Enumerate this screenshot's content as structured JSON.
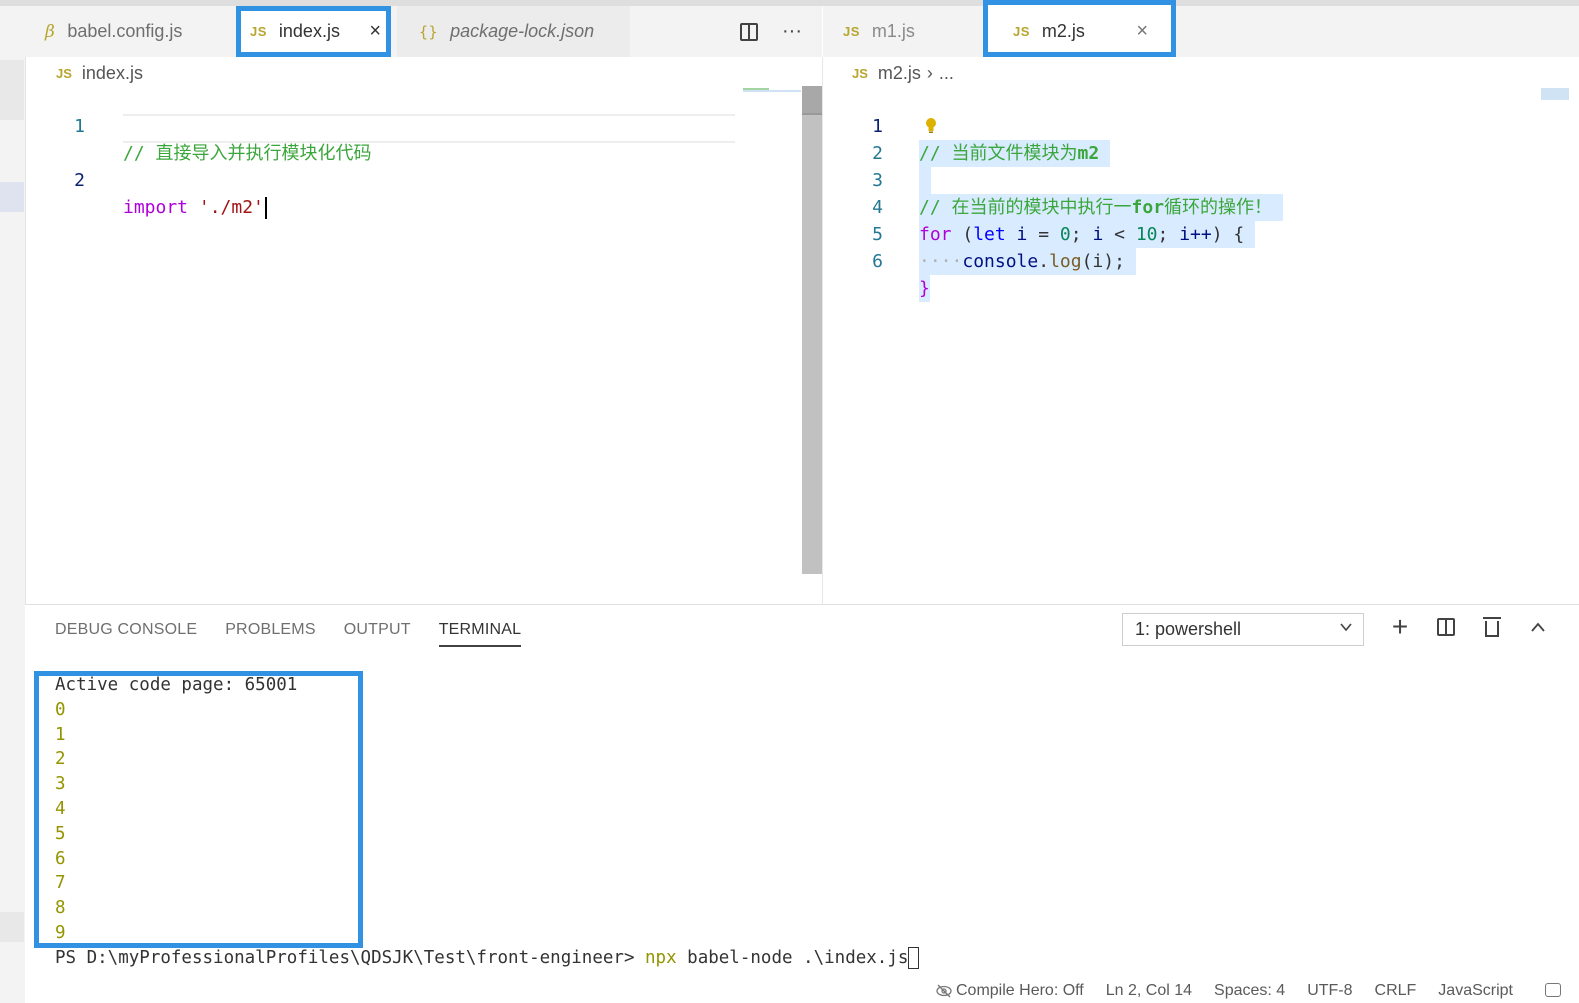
{
  "left_group": {
    "tabs": [
      {
        "icon": "babel-icon",
        "glyph": "β",
        "label": "babel.config.js",
        "active": false
      },
      {
        "icon": "js-icon",
        "glyph": "JS",
        "label": "index.js",
        "active": true,
        "close": "×"
      },
      {
        "icon": "json-icon",
        "glyph": "{}",
        "label": "package-lock.json",
        "active": false
      }
    ],
    "actions_more": "···",
    "breadcrumb": {
      "icon_glyph": "JS",
      "file": "index.js"
    },
    "lines": [
      {
        "n": "1",
        "comment": "// 直接导入并执行模块化代码"
      },
      {
        "n": "2",
        "kw": "import",
        "str": "'./m2'"
      }
    ]
  },
  "right_group": {
    "tabs": [
      {
        "icon": "js-icon",
        "glyph": "JS",
        "label": "m1.js",
        "active": false
      },
      {
        "icon": "js-icon",
        "glyph": "JS",
        "label": "m2.js",
        "active": true,
        "close": "×"
      }
    ],
    "breadcrumb": {
      "icon_glyph": "JS",
      "file": "m2.js",
      "sep": "›",
      "rest": "..."
    },
    "line_numbers": [
      "1",
      "2",
      "3",
      "4",
      "5",
      "6"
    ],
    "code": {
      "l1_comment": "// 当前文件模块为",
      "l1_tail": "m2",
      "l3_comment": "// 在当前的模块中执行一",
      "l3_for": "for",
      "l3_tail": "循环的操作！",
      "l4_for": "for",
      "l4_open": " (",
      "l4_let": "let",
      "l4_i": " i",
      "l4_eq": " = ",
      "l4_zero": "0",
      "l4_semi": "; ",
      "l4_i2": "i",
      "l4_lt": " < ",
      "l4_ten": "10",
      "l4_semi2": "; ",
      "l4_inc": "i++",
      "l4_close": ") {",
      "l5_indent": "····",
      "l5_console": "console",
      "l5_dot": ".",
      "l5_log": "log",
      "l5_args": "(i);",
      "l6": "}"
    }
  },
  "panel": {
    "tabs": [
      "DEBUG CONSOLE",
      "PROBLEMS",
      "OUTPUT",
      "TERMINAL"
    ],
    "active_tab": "TERMINAL",
    "terminal_select": "1: powershell",
    "plus": "+",
    "collapse": "^",
    "terminal_lines": [
      "Active code page: 65001",
      "0",
      "1",
      "2",
      "3",
      "4",
      "5",
      "6",
      "7",
      "8",
      "9"
    ],
    "prompt": "PS D:\\myProfessionalProfiles\\QDSJK\\Test\\front-engineer> ",
    "prompt_cmd": "npx",
    "prompt_args": " babel-node .\\index.js"
  },
  "statusbar": {
    "compile_hero": "Compile Hero: Off",
    "position": "Ln 2, Col 14",
    "spaces": "Spaces: 4",
    "encoding": "UTF-8",
    "eol": "CRLF",
    "language": "JavaScript"
  },
  "colors": {
    "highlight": "#3191e3",
    "comment": "#3ba63b",
    "keyword": "#af00db",
    "string": "#a31515",
    "terminal_number": "#949400",
    "selection": "#d9ebff"
  }
}
